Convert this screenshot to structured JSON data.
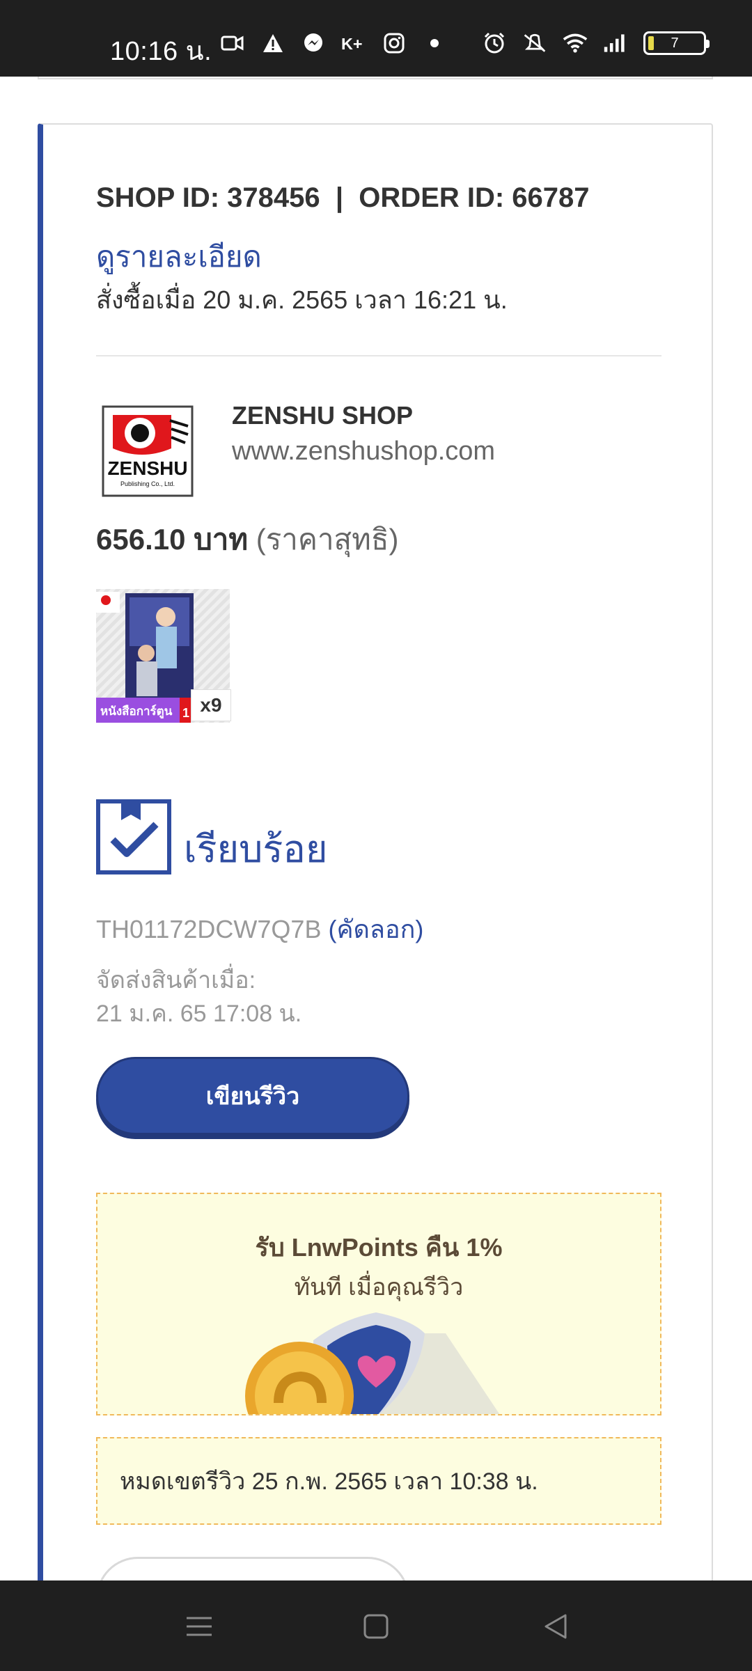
{
  "status_bar": {
    "time": "10:16 น.",
    "battery_level": "7",
    "icons_left": [
      "video-camera-icon",
      "warning-icon",
      "messenger-icon",
      "k-plus-icon",
      "instagram-icon",
      "dot-icon"
    ],
    "icons_right": [
      "alarm-icon",
      "mute-icon",
      "wifi-icon",
      "signal-icon",
      "battery-icon"
    ]
  },
  "order": {
    "ids_text": "SHOP ID: 378456  |  ORDER ID: 66787",
    "view_details": "ดูรายละเอียด",
    "order_date": "สั่งซื้อเมื่อ 20 ม.ค. 2565 เวลา 16:21 น."
  },
  "shop": {
    "logo_text": "ZENSHU",
    "name": "ZENSHU SHOP",
    "url": "www.zenshushop.com"
  },
  "price": {
    "amount": "656.10 บาท",
    "note": "(ราคาสุทธิ)"
  },
  "product": {
    "quantity": "x9",
    "category_label": "หนังสือการ์ตูน"
  },
  "shipping": {
    "status": "เรียบร้อย",
    "tracking_number": "TH01172DCW7Q7B",
    "copy_label": "(คัดลอก)",
    "shipped_label": "จัดส่งสินค้าเมื่อ:",
    "shipped_date": "21 ม.ค. 65 17:08 น."
  },
  "review": {
    "button_label": "เขียนรีวิว",
    "promo_title": "รับ LnwPoints คืน 1%",
    "promo_sub": "ทันที เมื่อคุณรีวิว",
    "deadline": "หมดเขตรีวิว 25 ก.พ. 2565 เวลา 10:38 น."
  },
  "colors": {
    "accent": "#2f4da1",
    "promo_bg": "#fdfde0",
    "promo_border": "#f0b95a"
  },
  "nav_bar": {
    "icons": [
      "menu-icon",
      "home-square-icon",
      "back-triangle-icon"
    ]
  }
}
